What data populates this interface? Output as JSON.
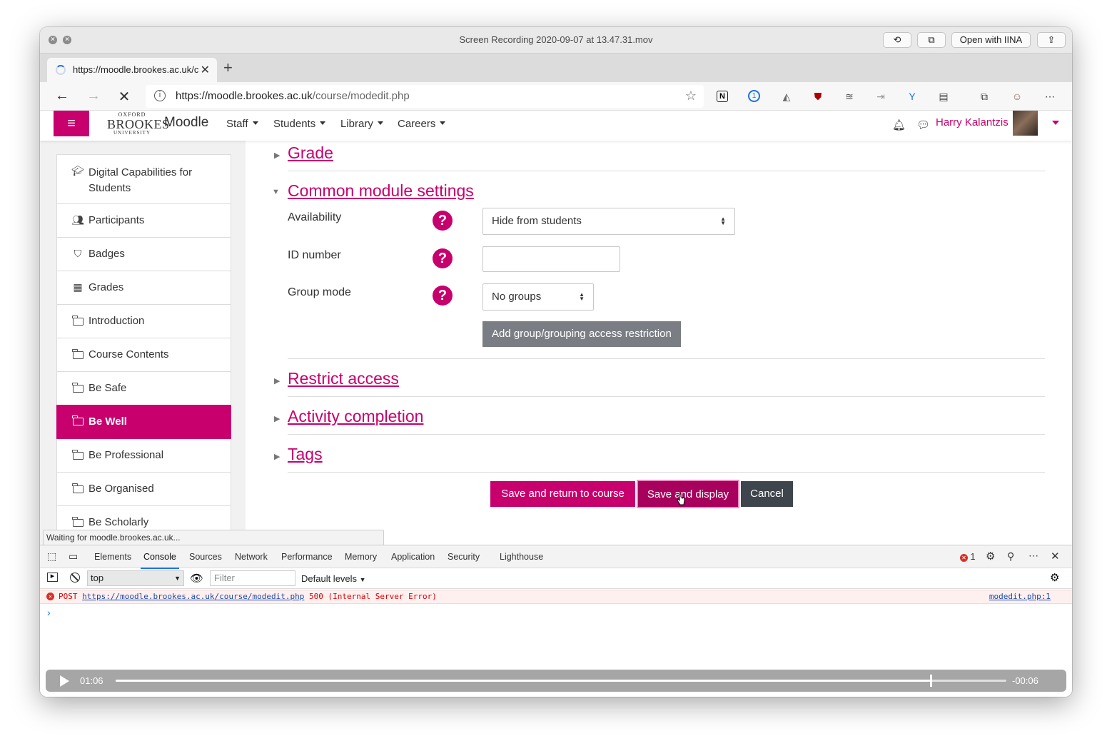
{
  "window": {
    "title": "Screen Recording 2020-09-07 at 13.47.31.mov",
    "open_with": "Open with IINA"
  },
  "browser": {
    "tab_title": "https://moodle.brookes.ac.uk/c",
    "url_host": "https://moodle.brookes.ac.uk",
    "url_path": "/course/modedit.php",
    "status_text": "Waiting for moodle.brookes.ac.uk..."
  },
  "navbar": {
    "logo_line1": "OXFORD",
    "logo_line2": "BROOKES",
    "logo_line3": "UNIVERSITY",
    "site_name": "Moodle",
    "menus": [
      "Staff",
      "Students",
      "Library",
      "Careers"
    ],
    "user_name": "Harry Kalantzis"
  },
  "sidebar": {
    "items": [
      {
        "label": "Digital Capabilities for Students",
        "icon": "graduation-cap-icon"
      },
      {
        "label": "Participants",
        "icon": "users-icon"
      },
      {
        "label": "Badges",
        "icon": "shield-icon"
      },
      {
        "label": "Grades",
        "icon": "table-icon"
      },
      {
        "label": "Introduction",
        "icon": "folder-icon"
      },
      {
        "label": "Course Contents",
        "icon": "folder-icon"
      },
      {
        "label": "Be Safe",
        "icon": "folder-icon"
      },
      {
        "label": "Be Well",
        "icon": "folder-icon",
        "active": true
      },
      {
        "label": "Be Professional",
        "icon": "folder-icon"
      },
      {
        "label": "Be Organised",
        "icon": "folder-icon"
      },
      {
        "label": "Be Scholarly",
        "icon": "folder-icon"
      }
    ]
  },
  "form": {
    "sections": {
      "grade": "Grade",
      "common": "Common module settings",
      "restrict": "Restrict access",
      "completion": "Activity completion",
      "tags": "Tags"
    },
    "availability_label": "Availability",
    "availability_value": "Hide from students",
    "idnumber_label": "ID number",
    "idnumber_value": "",
    "groupmode_label": "Group mode",
    "groupmode_value": "No groups",
    "add_restriction": "Add group/grouping access restriction",
    "save_return": "Save and return to course",
    "save_display": "Save and display",
    "cancel": "Cancel"
  },
  "devtools": {
    "tabs": [
      "Elements",
      "Console",
      "Sources",
      "Network",
      "Performance",
      "Memory",
      "Application",
      "Security",
      "Lighthouse"
    ],
    "active_tab": "Console",
    "error_count": "1",
    "context": "top",
    "filter_placeholder": "Filter",
    "levels": "Default levels",
    "error": {
      "method": "POST",
      "url": "https://moodle.brookes.ac.uk/course/modedit.php",
      "status": "500 (Internal Server Error)",
      "source": "modedit.php:1"
    }
  },
  "player": {
    "elapsed": "01:06",
    "remaining": "-00:06",
    "progress": 0.914
  },
  "colors": {
    "brand": "#c7006e",
    "cancel": "#3f454c"
  }
}
